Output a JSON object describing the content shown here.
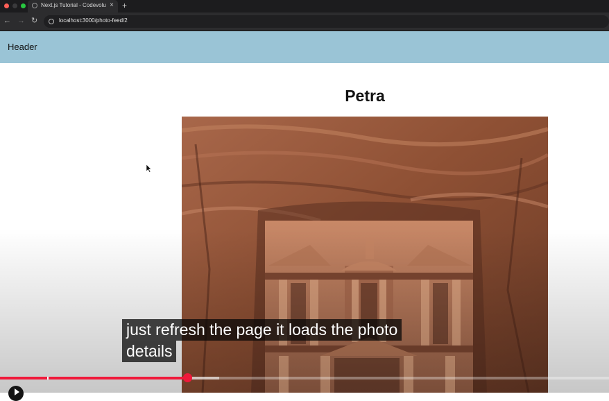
{
  "browser": {
    "tab_title": "Next.js Tutorial - Codevolution",
    "url": "localhost:3000/photo-feed/2",
    "tab_close_glyph": "×",
    "new_tab_glyph": "+",
    "back_glyph": "←",
    "forward_glyph": "→",
    "reload_glyph": "↻"
  },
  "page": {
    "header_label": "Header",
    "photo_title": "Petra"
  },
  "video": {
    "caption_line1": "just refresh the page it loads the photo",
    "caption_line2": "details",
    "progress": 0.307,
    "buffered": 0.36,
    "accent": "#f0193a"
  }
}
